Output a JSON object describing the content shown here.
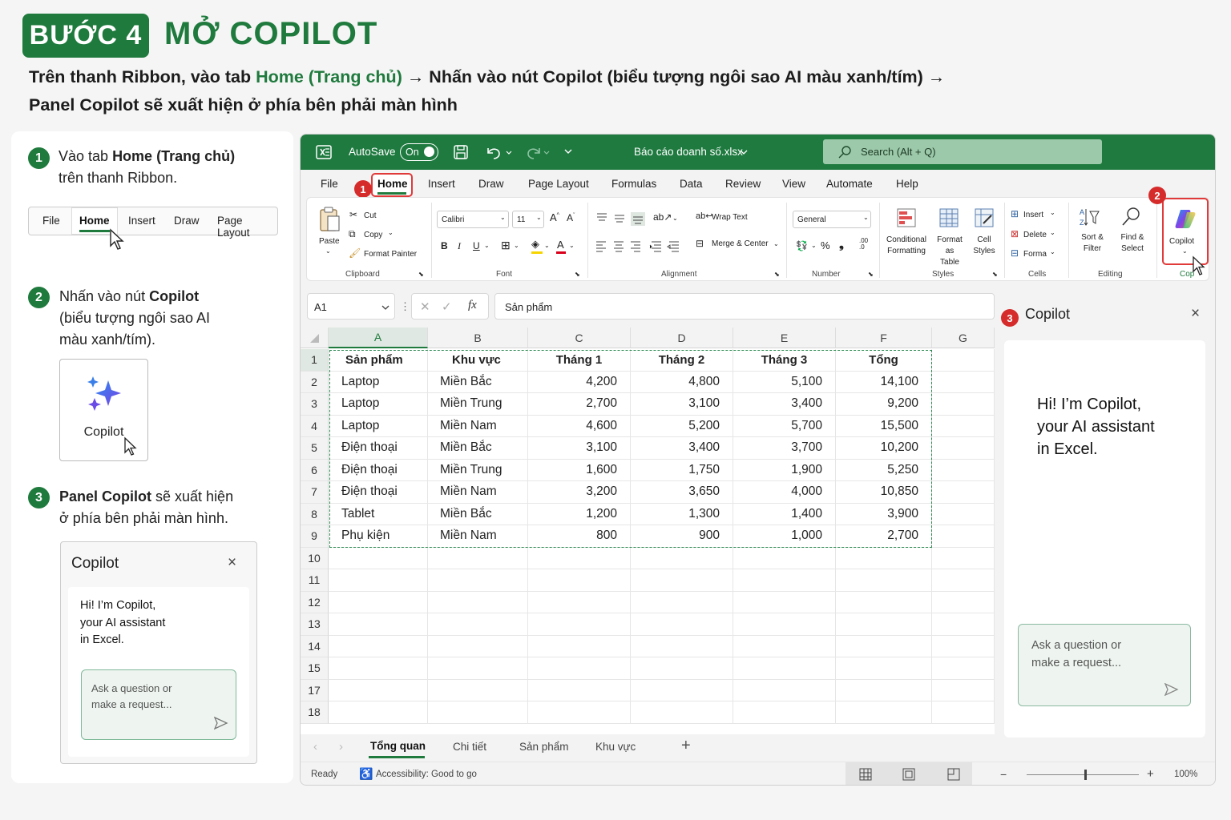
{
  "header": {
    "badge": "BƯỚC 4",
    "title": "MỞ COPILOT",
    "line1_a": "Trên thanh Ribbon, vào tab ",
    "line1_b": "Home (Trang chủ)",
    "line1_c": " → Nhấn vào nút Copilot (biểu tượng ngôi sao AI màu xanh/tím) →",
    "line2": "Panel Copilot sẽ xuất hiện ở phía bên phải màn hình"
  },
  "steps": [
    {
      "num": "1",
      "text_a": "Vào tab ",
      "text_b": "Home (Trang chủ)",
      "text_c": "trên thanh Ribbon."
    },
    {
      "num": "2",
      "text_a": "Nhấn vào nút ",
      "text_b": "Copilot",
      "text_c": "(biểu tượng ngôi sao AI",
      "text_d": "màu xanh/tím)."
    },
    {
      "num": "3",
      "text_b": "Panel Copilot",
      "text_a": " sẽ xuất hiện",
      "text_c": "ở phía bên phải màn hình."
    }
  ],
  "mini_tabs": [
    "File",
    "Home",
    "Insert",
    "Draw",
    "Page Layout"
  ],
  "mini_copilot_label": "Copilot",
  "mini_panel": {
    "title": "Copilot",
    "greeting": [
      "Hi! I’m Copilot,",
      "your AI assistant",
      "in Excel."
    ],
    "ask": [
      "Ask a question or",
      "make a request..."
    ]
  },
  "titlebar": {
    "autosave": "AutoSave",
    "toggle": "On",
    "filename": "Báo cáo doanh số.xlsx",
    "search": "Search (Alt + Q)"
  },
  "menu": [
    "File",
    "Home",
    "Insert",
    "Draw",
    "Page Layout",
    "Formulas",
    "Data",
    "Review",
    "View",
    "Automate",
    "Help"
  ],
  "ribbon": {
    "paste": "Paste",
    "cut": "Cut",
    "copy": "Copy",
    "format_painter": "Format Painter",
    "clipboard": "Clipboard",
    "font_name": "Calibri",
    "font_size": "11",
    "font": "Font",
    "wrap_text": "Wrap Text",
    "merge_center": "Merge & Center",
    "alignment": "Alignment",
    "number_format": "General",
    "number": "Number",
    "conditional": [
      "Conditional",
      "Formatting"
    ],
    "format_as": [
      "Format as",
      "Table"
    ],
    "cell_styles": [
      "Cell",
      "Styles"
    ],
    "styles": "Styles",
    "insert": "Insert",
    "delete": "Delete",
    "format": "Forma",
    "cells": "Cells",
    "sort": [
      "Sort &",
      "Filter"
    ],
    "find": [
      "Find &",
      "Select"
    ],
    "editing": "Editing",
    "copilot": "Copilot",
    "copilot_group": "Cop"
  },
  "formula": {
    "namebox": "A1",
    "fx": "fx",
    "value": "Sản phẩm"
  },
  "columns": [
    "A",
    "B",
    "C",
    "D",
    "E",
    "F",
    "G"
  ],
  "rows": [
    "1",
    "2",
    "3",
    "4",
    "5",
    "6",
    "7",
    "8",
    "9",
    "10",
    "11",
    "12",
    "13",
    "14",
    "15",
    "17",
    "18"
  ],
  "table": {
    "headers": [
      "Sản phẩm",
      "Khu vực",
      "Tháng 1",
      "Tháng 2",
      "Tháng 3",
      "Tổng"
    ],
    "data": [
      [
        "Laptop",
        "Miền Bắc",
        "4,200",
        "4,800",
        "5,100",
        "14,100"
      ],
      [
        "Laptop",
        "Miền Trung",
        "2,700",
        "3,100",
        "3,400",
        "9,200"
      ],
      [
        "Laptop",
        "Miền Nam",
        "4,600",
        "5,200",
        "5,700",
        "15,500"
      ],
      [
        "Điện thoại",
        "Miền Bắc",
        "3,100",
        "3,400",
        "3,700",
        "10,200"
      ],
      [
        "Điện thoại",
        "Miền Trung",
        "1,600",
        "1,750",
        "1,900",
        "5,250"
      ],
      [
        "Điện thoại",
        "Miền Nam",
        "3,200",
        "3,650",
        "4,000",
        "10,850"
      ],
      [
        "Tablet",
        "Miền Bắc",
        "1,200",
        "1,300",
        "1,400",
        "3,900"
      ],
      [
        "Phụ kiện",
        "Miền Nam",
        "800",
        "900",
        "1,000",
        "2,700"
      ]
    ]
  },
  "sheets": [
    "Tổng quan",
    "Chi tiết",
    "Sản phẩm",
    "Khu vực"
  ],
  "status": {
    "ready": "Ready",
    "accessibility": "Accessibility: Good to go",
    "zoom": "100%"
  },
  "copilot_panel": {
    "num": "3",
    "title": "Copilot",
    "greeting": [
      "Hi! I’m Copilot,",
      "your AI assistant",
      "in Excel."
    ],
    "ask": [
      "Ask a question or",
      "make a request..."
    ]
  },
  "callouts": {
    "one": "1",
    "two": "2"
  },
  "colors": {
    "accent": "#1f7a3d",
    "callout": "#d62b2b"
  }
}
